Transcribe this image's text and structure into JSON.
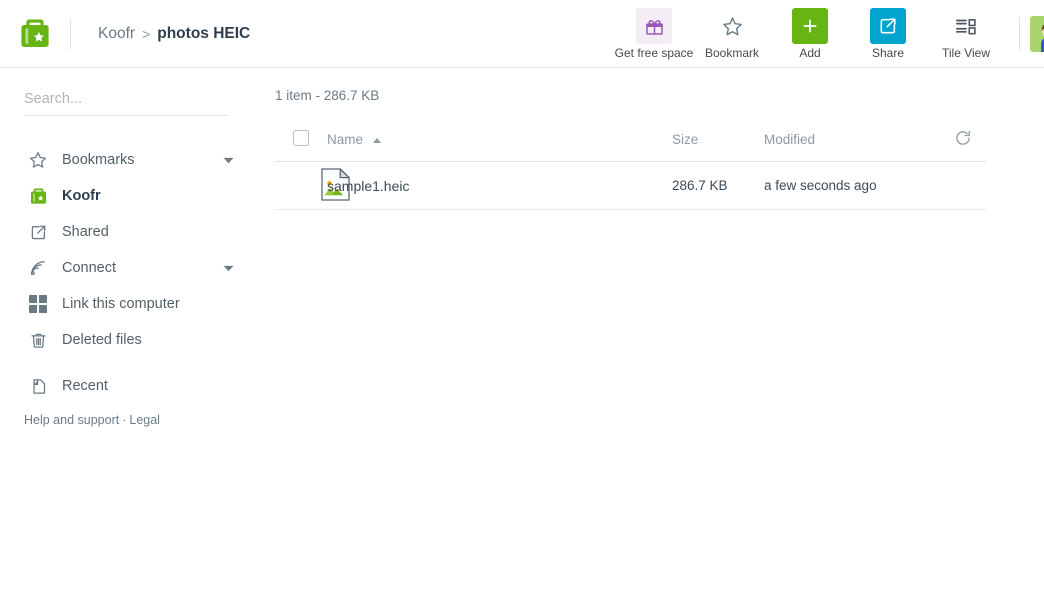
{
  "app": {
    "logo_icon": "koofr-folder-star-logo",
    "brand_color": "#66b512"
  },
  "breadcrumb": {
    "root": "Koofr",
    "separator": ">",
    "current": "photos HEIC"
  },
  "toolbar": {
    "items": [
      {
        "label": "Get free space",
        "icon": "gift-icon",
        "icon_color": "#9b59b6",
        "bg": "#f4edf6"
      },
      {
        "label": "Bookmark",
        "icon": "star-outline-icon",
        "icon_color": "#6b7b86",
        "bg": "transparent"
      },
      {
        "label": "Add",
        "icon": "plus-icon",
        "icon_color": "#ffffff",
        "bg": "#66b512"
      },
      {
        "label": "Share",
        "icon": "external-link-icon",
        "icon_color": "#ffffff",
        "bg": "#00a4cc"
      },
      {
        "label": "Tile View",
        "icon": "tile-view-icon",
        "icon_color": "#4a5560",
        "bg": "transparent"
      }
    ],
    "avatar": "user-avatar"
  },
  "sidebar": {
    "search": {
      "placeholder": "Search...",
      "value": ""
    },
    "items": [
      {
        "label": "Bookmarks",
        "icon": "star-outline-icon",
        "active": false,
        "caret": true
      },
      {
        "label": "Koofr",
        "icon": "koofr-folder-star-logo",
        "active": true,
        "caret": false
      },
      {
        "label": "Shared",
        "icon": "shared-external-link-icon",
        "active": false,
        "caret": false
      },
      {
        "label": "Connect",
        "icon": "connect-rss-icon",
        "active": false,
        "caret": true
      },
      {
        "label": "Link this computer",
        "icon": "grid-squares-icon",
        "active": false,
        "caret": false
      },
      {
        "label": "Deleted files",
        "icon": "trash-icon",
        "active": false,
        "caret": false
      },
      {
        "label": "Recent",
        "icon": "recent-page-icon",
        "active": false,
        "caret": false
      }
    ],
    "footer": {
      "help": "Help and support",
      "dot": "·",
      "legal": "Legal"
    }
  },
  "main": {
    "summary": "1 item - 286.7 KB",
    "columns": {
      "name": "Name",
      "size": "Size",
      "modified": "Modified"
    },
    "sort": {
      "column": "Name",
      "direction": "asc"
    },
    "refresh_icon": "refresh-icon",
    "select_all_checked": false,
    "rows": [
      {
        "icon": "image-file-icon",
        "name": "sample1.heic",
        "size": "286.7 KB",
        "modified": "a few seconds ago"
      }
    ]
  }
}
